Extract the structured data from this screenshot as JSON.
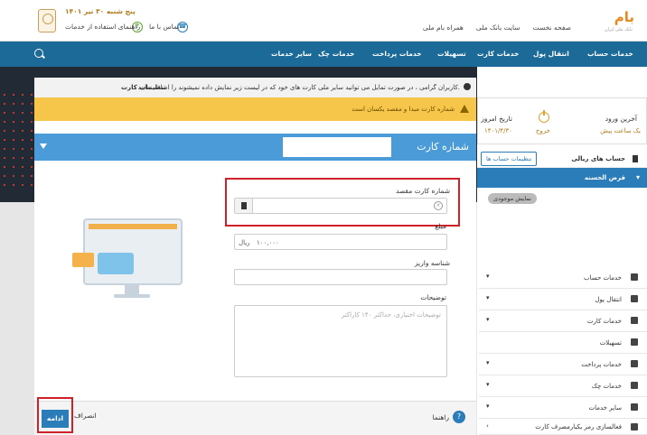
{
  "header": {
    "brand": "بام",
    "brand_sub": "بانک ملی ایران",
    "links": [
      "صفحه نخست",
      "سایت بانک ملی",
      "همراه بام ملی"
    ],
    "date": "پنج شنبه ۳۰ تیر ۱۴۰۱",
    "contact": "تماس با ما",
    "guide": "راهنمای استفاده از خدمات"
  },
  "nav": {
    "items": [
      "خدمات حساب",
      "انتقال پول",
      "خدمات کارت",
      "تسهیلات",
      "خدمات پرداخت",
      "خدمات چک",
      "سایر خدمات"
    ]
  },
  "sidebar": {
    "last_login_label": "آخرین ورود",
    "last_login_value": "یک ساعت پیش",
    "logout": "خروج",
    "today_label": "تاریخ امروز",
    "today_value": "۱۴۰۱/۴/۳۰",
    "accounts_label": "حساب های ریالی",
    "accounts_settings": "تنظیمات حساب ها",
    "qard_label": "قرض الحسنه",
    "show_balance": "نمایش موجودی",
    "menu": [
      "خدمات حساب",
      "انتقال پول",
      "خدمات کارت",
      "تسهیلات",
      "خدمات پرداخت",
      "خدمات چک",
      "سایر خدمات",
      "فعالسازی رمز یکبارمصرف کارت"
    ]
  },
  "modal": {
    "notice1": "کاربران گرامی ، در صورت تمایل می توانید سایر ملی کارت های خود که در لیست زیر نمایش داده نمیشوند را اضافه نمایید.",
    "notice1_link": "تنظیمات کارت",
    "notice2": "شماره کارت مبدا و مقصد یکسان است",
    "card_title": "شماره کارت",
    "dest_label": "شماره کارت مقصد",
    "amount_label": "مبلغ",
    "amount_value": "۱۰۰,۰۰۰",
    "amount_unit": "ریال",
    "deposit_id_label": "شناسه واریز",
    "desc_label": "توضیحات",
    "desc_placeholder": "توضیحات اختیاری، حداکثر ۱۴۰ کاراکتر",
    "help": "راهنما",
    "cancel": "انصراف",
    "continue": "ادامه"
  },
  "colors": {
    "nav": "#1b6a97",
    "accent": "#2a7db8",
    "warning": "#f6c64a",
    "highlight": "#d0202a",
    "brand": "#e8891f"
  }
}
